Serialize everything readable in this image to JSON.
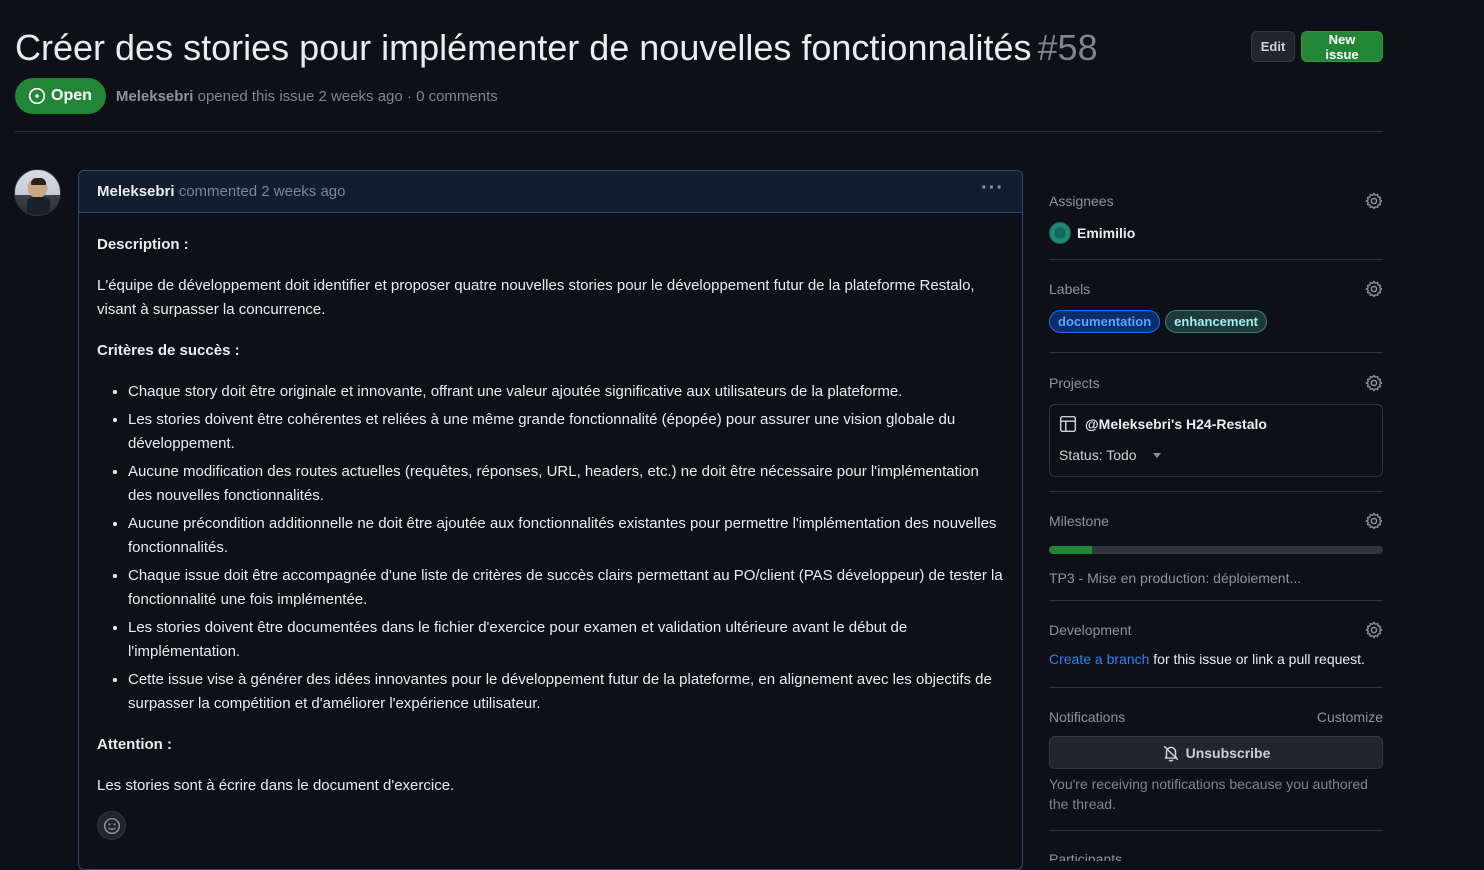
{
  "issue": {
    "title": "Créer des stories pour implémenter de nouvelles fonctionnalités",
    "number": "#58",
    "state": "Open",
    "author": "Meleksebri",
    "opened_text": "opened this issue 2 weeks ago · 0 comments"
  },
  "header_buttons": {
    "edit_label": "Edit",
    "new_issue_label": "New issue"
  },
  "comment": {
    "author": "Meleksebri",
    "action": "commented 2 weeks ago",
    "description_heading": "Description :",
    "description_text": "L'équipe de développement doit identifier et proposer quatre nouvelles stories pour le développement futur de la plateforme Restalo, visant à surpasser la concurrence.",
    "criteria_heading": "Critères de succès :",
    "criteria": [
      "Chaque story doit être originale et innovante, offrant une valeur ajoutée significative aux utilisateurs de la plateforme.",
      "Les stories doivent être cohérentes et reliées à une même grande fonctionnalité (épopée) pour assurer une vision globale du développement.",
      "Aucune modification des routes actuelles (requêtes, réponses, URL, headers, etc.) ne doit être nécessaire pour l'implémentation des nouvelles fonctionnalités.",
      "Aucune précondition additionnelle ne doit être ajoutée aux fonctionnalités existantes pour permettre l'implémentation des nouvelles fonctionnalités.",
      "Chaque issue doit être accompagnée d'une liste de critères de succès clairs permettant au PO/client (PAS développeur) de tester la fonctionnalité une fois implémentée.",
      "Les stories doivent être documentées dans le fichier d'exercice pour examen et validation ultérieure avant le début de l'implémentation.",
      "Cette issue vise à générer des idées innovantes pour le développement futur de la plateforme, en alignement avec les objectifs de surpasser la compétition et d'améliorer l'expérience utilisateur."
    ],
    "attention_heading": "Attention :",
    "attention_text": "Les stories sont à écrire dans le document d'exercice."
  },
  "sidebar": {
    "assignees": {
      "title": "Assignees",
      "name": "Emimilio"
    },
    "labels": {
      "title": "Labels",
      "items": [
        "documentation",
        "enhancement"
      ]
    },
    "projects": {
      "title": "Projects",
      "name": "@Meleksebri's H24-Restalo",
      "status": "Status: Todo"
    },
    "milestone": {
      "title": "Milestone",
      "progress_percent": 13,
      "name": "TP3 - Mise en production: déploiement..."
    },
    "development": {
      "title": "Development",
      "link_text": "Create a branch",
      "rest_text": " for this issue or link a pull request."
    },
    "notifications": {
      "title": "Notifications",
      "customize": "Customize",
      "unsubscribe_label": "Unsubscribe",
      "note": "You're receiving notifications because you authored the thread."
    },
    "participants": {
      "title": "Participants"
    }
  },
  "colors": {
    "background": "#0d1117",
    "open_green": "#238636",
    "link_blue": "#2f81f7"
  }
}
